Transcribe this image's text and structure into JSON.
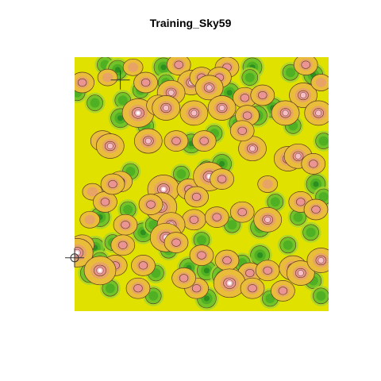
{
  "chart_data": {
    "type": "heatmap",
    "title": "Training_Sky59",
    "xlabel": "",
    "ylabel": "",
    "colormap": {
      "background": "#e1e100",
      "levels": [
        "#e1e100",
        "#e9bd3a",
        "#e8a466",
        "#eb9494",
        "#f4bfc6",
        "#ffffff"
      ],
      "cool": [
        "#a5d62f",
        "#72c32a",
        "#4fb023",
        "#2c8f1f"
      ],
      "contour_color": "#5b3a1e"
    },
    "markers": [
      {
        "shape": "cross",
        "x": 0.18,
        "y": 0.09
      },
      {
        "shape": "cross-circle",
        "x": 0.0,
        "y": 0.79
      }
    ],
    "hotspots": [
      {
        "x": 0.23,
        "y": 0.04,
        "v": 1
      },
      {
        "x": 0.41,
        "y": 0.03,
        "v": 2
      },
      {
        "x": 0.6,
        "y": 0.04,
        "v": 2
      },
      {
        "x": 0.91,
        "y": 0.03,
        "v": 2
      },
      {
        "x": 0.13,
        "y": 0.08,
        "v": 1
      },
      {
        "x": 0.46,
        "y": 0.1,
        "v": 3
      },
      {
        "x": 0.5,
        "y": 0.08,
        "v": 2
      },
      {
        "x": 0.57,
        "y": 0.08,
        "v": 2
      },
      {
        "x": 0.03,
        "y": 0.1,
        "v": 2
      },
      {
        "x": 0.28,
        "y": 0.1,
        "v": 2
      },
      {
        "x": 0.38,
        "y": 0.14,
        "v": 3
      },
      {
        "x": 0.53,
        "y": 0.12,
        "v": 3
      },
      {
        "x": 0.67,
        "y": 0.16,
        "v": 2
      },
      {
        "x": 0.74,
        "y": 0.15,
        "v": 2
      },
      {
        "x": 0.9,
        "y": 0.15,
        "v": 3
      },
      {
        "x": 0.97,
        "y": 0.1,
        "v": 1
      },
      {
        "x": 0.25,
        "y": 0.22,
        "v": 4
      },
      {
        "x": 0.33,
        "y": 0.19,
        "v": 2
      },
      {
        "x": 0.36,
        "y": 0.2,
        "v": 3
      },
      {
        "x": 0.47,
        "y": 0.22,
        "v": 3
      },
      {
        "x": 0.58,
        "y": 0.2,
        "v": 3
      },
      {
        "x": 0.68,
        "y": 0.23,
        "v": 2
      },
      {
        "x": 0.83,
        "y": 0.22,
        "v": 3
      },
      {
        "x": 0.96,
        "y": 0.22,
        "v": 3
      },
      {
        "x": 0.11,
        "y": 0.33,
        "v": 2
      },
      {
        "x": 0.14,
        "y": 0.35,
        "v": 3
      },
      {
        "x": 0.29,
        "y": 0.33,
        "v": 3
      },
      {
        "x": 0.4,
        "y": 0.33,
        "v": 2
      },
      {
        "x": 0.51,
        "y": 0.33,
        "v": 2
      },
      {
        "x": 0.7,
        "y": 0.36,
        "v": 3
      },
      {
        "x": 0.84,
        "y": 0.4,
        "v": 3
      },
      {
        "x": 0.88,
        "y": 0.39,
        "v": 3
      },
      {
        "x": 0.94,
        "y": 0.42,
        "v": 2
      },
      {
        "x": 0.18,
        "y": 0.49,
        "v": 2
      },
      {
        "x": 0.35,
        "y": 0.52,
        "v": 4
      },
      {
        "x": 0.45,
        "y": 0.52,
        "v": 2
      },
      {
        "x": 0.53,
        "y": 0.47,
        "v": 4
      },
      {
        "x": 0.58,
        "y": 0.48,
        "v": 2
      },
      {
        "x": 0.07,
        "y": 0.53,
        "v": 1
      },
      {
        "x": 0.34,
        "y": 0.59,
        "v": 4
      },
      {
        "x": 0.3,
        "y": 0.58,
        "v": 2
      },
      {
        "x": 0.47,
        "y": 0.64,
        "v": 2
      },
      {
        "x": 0.56,
        "y": 0.63,
        "v": 2
      },
      {
        "x": 0.66,
        "y": 0.61,
        "v": 2
      },
      {
        "x": 0.76,
        "y": 0.64,
        "v": 3
      },
      {
        "x": 0.89,
        "y": 0.57,
        "v": 2
      },
      {
        "x": 0.2,
        "y": 0.66,
        "v": 2
      },
      {
        "x": 0.38,
        "y": 0.66,
        "v": 3
      },
      {
        "x": 0.36,
        "y": 0.71,
        "v": 4
      },
      {
        "x": 0.4,
        "y": 0.73,
        "v": 2
      },
      {
        "x": 0.19,
        "y": 0.74,
        "v": 2
      },
      {
        "x": 0.03,
        "y": 0.74,
        "v": 2
      },
      {
        "x": 0.01,
        "y": 0.77,
        "v": 4
      },
      {
        "x": 0.16,
        "y": 0.82,
        "v": 2
      },
      {
        "x": 0.1,
        "y": 0.84,
        "v": 4
      },
      {
        "x": 0.27,
        "y": 0.82,
        "v": 2
      },
      {
        "x": 0.5,
        "y": 0.78,
        "v": 2
      },
      {
        "x": 0.6,
        "y": 0.8,
        "v": 2
      },
      {
        "x": 0.69,
        "y": 0.85,
        "v": 2
      },
      {
        "x": 0.76,
        "y": 0.84,
        "v": 2
      },
      {
        "x": 0.86,
        "y": 0.83,
        "v": 3
      },
      {
        "x": 0.89,
        "y": 0.85,
        "v": 3
      },
      {
        "x": 0.97,
        "y": 0.8,
        "v": 3
      },
      {
        "x": 0.25,
        "y": 0.91,
        "v": 2
      },
      {
        "x": 0.48,
        "y": 0.91,
        "v": 2
      },
      {
        "x": 0.61,
        "y": 0.89,
        "v": 4
      },
      {
        "x": 0.7,
        "y": 0.91,
        "v": 2
      },
      {
        "x": 0.82,
        "y": 0.92,
        "v": 2
      },
      {
        "x": 0.43,
        "y": 0.87,
        "v": 2
      },
      {
        "x": 0.12,
        "y": 0.57,
        "v": 2
      },
      {
        "x": 0.48,
        "y": 0.55,
        "v": 2
      },
      {
        "x": 0.06,
        "y": 0.64,
        "v": 1
      },
      {
        "x": 0.76,
        "y": 0.5,
        "v": 1
      },
      {
        "x": 0.66,
        "y": 0.29,
        "v": 2
      },
      {
        "x": 0.95,
        "y": 0.6,
        "v": 2
      },
      {
        "x": 0.15,
        "y": 0.5,
        "v": 2
      }
    ],
    "coolspots": [
      {
        "x": 0.12,
        "y": 0.03,
        "v": 2
      },
      {
        "x": 0.17,
        "y": 0.05,
        "v": 3
      },
      {
        "x": 0.35,
        "y": 0.04,
        "v": 3
      },
      {
        "x": 0.7,
        "y": 0.04,
        "v": 3
      },
      {
        "x": 0.85,
        "y": 0.06,
        "v": 2
      },
      {
        "x": 0.36,
        "y": 0.1,
        "v": 2
      },
      {
        "x": 0.69,
        "y": 0.08,
        "v": 2
      },
      {
        "x": 0.94,
        "y": 0.07,
        "v": 3
      },
      {
        "x": 0.01,
        "y": 0.14,
        "v": 2
      },
      {
        "x": 0.08,
        "y": 0.18,
        "v": 2
      },
      {
        "x": 0.19,
        "y": 0.17,
        "v": 2
      },
      {
        "x": 0.26,
        "y": 0.13,
        "v": 2
      },
      {
        "x": 0.61,
        "y": 0.14,
        "v": 3
      },
      {
        "x": 0.78,
        "y": 0.2,
        "v": 3
      },
      {
        "x": 0.64,
        "y": 0.26,
        "v": 2
      },
      {
        "x": 0.72,
        "y": 0.23,
        "v": 3
      },
      {
        "x": 0.86,
        "y": 0.27,
        "v": 2
      },
      {
        "x": 0.18,
        "y": 0.24,
        "v": 3
      },
      {
        "x": 0.28,
        "y": 0.27,
        "v": 2
      },
      {
        "x": 0.46,
        "y": 0.34,
        "v": 3
      },
      {
        "x": 0.55,
        "y": 0.3,
        "v": 2
      },
      {
        "x": 0.98,
        "y": 0.33,
        "v": 2
      },
      {
        "x": 0.52,
        "y": 0.44,
        "v": 2
      },
      {
        "x": 0.58,
        "y": 0.42,
        "v": 3
      },
      {
        "x": 0.95,
        "y": 0.5,
        "v": 3
      },
      {
        "x": 0.98,
        "y": 0.55,
        "v": 2
      },
      {
        "x": 0.1,
        "y": 0.63,
        "v": 3
      },
      {
        "x": 0.21,
        "y": 0.6,
        "v": 2
      },
      {
        "x": 0.27,
        "y": 0.69,
        "v": 3
      },
      {
        "x": 0.31,
        "y": 0.66,
        "v": 2
      },
      {
        "x": 0.73,
        "y": 0.67,
        "v": 3
      },
      {
        "x": 0.79,
        "y": 0.57,
        "v": 2
      },
      {
        "x": 0.08,
        "y": 0.75,
        "v": 3
      },
      {
        "x": 0.1,
        "y": 0.8,
        "v": 2
      },
      {
        "x": 0.15,
        "y": 0.73,
        "v": 2
      },
      {
        "x": 0.37,
        "y": 0.76,
        "v": 2
      },
      {
        "x": 0.5,
        "y": 0.72,
        "v": 2
      },
      {
        "x": 0.73,
        "y": 0.78,
        "v": 3
      },
      {
        "x": 0.84,
        "y": 0.74,
        "v": 2
      },
      {
        "x": 0.93,
        "y": 0.69,
        "v": 2
      },
      {
        "x": 0.06,
        "y": 0.85,
        "v": 3
      },
      {
        "x": 0.32,
        "y": 0.85,
        "v": 2
      },
      {
        "x": 0.45,
        "y": 0.83,
        "v": 3
      },
      {
        "x": 0.52,
        "y": 0.84,
        "v": 3
      },
      {
        "x": 0.58,
        "y": 0.86,
        "v": 3
      },
      {
        "x": 0.66,
        "y": 0.81,
        "v": 2
      },
      {
        "x": 0.94,
        "y": 0.88,
        "v": 2
      },
      {
        "x": 0.14,
        "y": 0.91,
        "v": 2
      },
      {
        "x": 0.31,
        "y": 0.94,
        "v": 2
      },
      {
        "x": 0.52,
        "y": 0.95,
        "v": 3
      },
      {
        "x": 0.77,
        "y": 0.95,
        "v": 2
      },
      {
        "x": 0.97,
        "y": 0.94,
        "v": 2
      },
      {
        "x": 0.22,
        "y": 0.45,
        "v": 2
      },
      {
        "x": 0.42,
        "y": 0.46,
        "v": 2
      },
      {
        "x": 0.62,
        "y": 0.66,
        "v": 2
      },
      {
        "x": 0.88,
        "y": 0.63,
        "v": 2
      }
    ]
  }
}
